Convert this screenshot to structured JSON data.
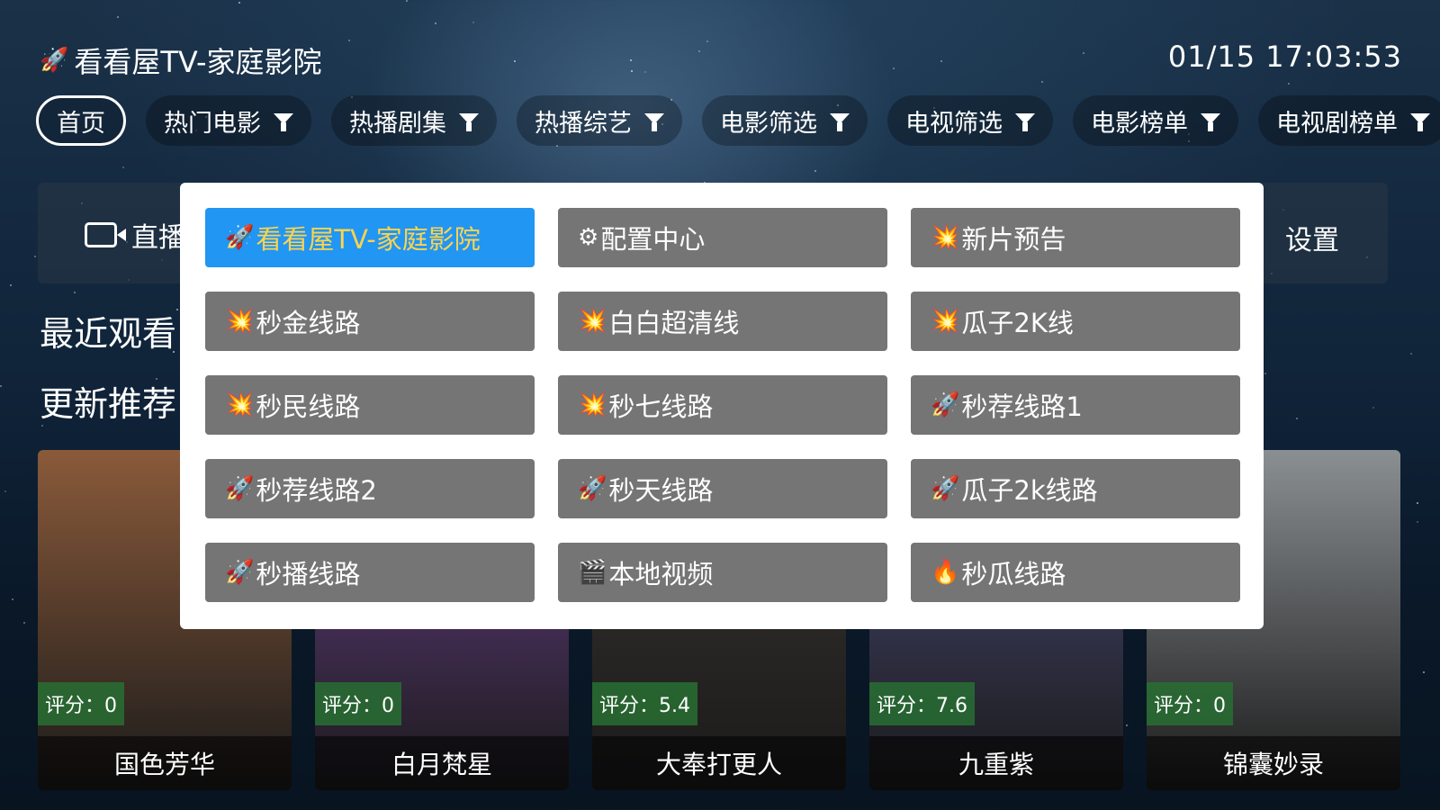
{
  "header": {
    "app_icon": "🚀",
    "app_title": "看看屋TV-家庭影院",
    "clock": "01/15 17:03:53"
  },
  "nav": {
    "tabs": [
      {
        "label": "首页",
        "filter": false,
        "active": true
      },
      {
        "label": "热门电影",
        "filter": true
      },
      {
        "label": "热播剧集",
        "filter": true
      },
      {
        "label": "热播综艺",
        "filter": true
      },
      {
        "label": "电影筛选",
        "filter": true
      },
      {
        "label": "电视筛选",
        "filter": true
      },
      {
        "label": "电影榜单",
        "filter": true
      },
      {
        "label": "电视剧榜单",
        "filter": true
      }
    ]
  },
  "quick_bar": {
    "live_label": "直播",
    "settings_label": "设置"
  },
  "sections": {
    "recent": "最近观看",
    "updates": "更新推荐"
  },
  "cards": [
    {
      "score": "评分：0",
      "title": "国色芳华",
      "bg": "#8a5a3a"
    },
    {
      "score": "评分：0",
      "title": "白月梵星",
      "bg": "#6a3f8a"
    },
    {
      "score": "评分：5.4",
      "title": "大奉打更人",
      "bg": "#3a3530"
    },
    {
      "score": "评分：7.6",
      "title": "九重紫",
      "bg": "#4a4a7a"
    },
    {
      "score": "评分：0",
      "title": "锦囊妙录",
      "bg": "#8a8f92"
    }
  ],
  "popup": {
    "items": [
      {
        "icon": "🚀",
        "label": "看看屋TV-家庭影院",
        "selected": true
      },
      {
        "icon": "⚙",
        "label": "配置中心"
      },
      {
        "icon": "💥",
        "label": "新片预告"
      },
      {
        "icon": "💥",
        "label": "秒金线路"
      },
      {
        "icon": "💥",
        "label": "白白超清线"
      },
      {
        "icon": "💥",
        "label": "瓜子2K线"
      },
      {
        "icon": "💥",
        "label": "秒民线路"
      },
      {
        "icon": "💥",
        "label": "秒七线路"
      },
      {
        "icon": "🚀",
        "label": "秒荐线路1"
      },
      {
        "icon": "🚀",
        "label": "秒荐线路2"
      },
      {
        "icon": "🚀",
        "label": "秒天线路"
      },
      {
        "icon": "🚀",
        "label": "瓜子2k线路"
      },
      {
        "icon": "🚀",
        "label": "秒播线路"
      },
      {
        "icon": "🎬",
        "label": "本地视频"
      },
      {
        "icon": "🔥",
        "label": "秒瓜线路"
      }
    ]
  }
}
